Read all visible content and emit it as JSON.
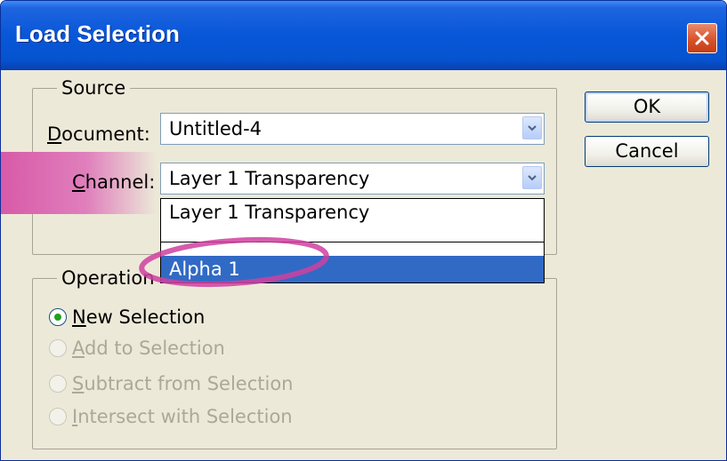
{
  "window": {
    "title": "Load Selection"
  },
  "source": {
    "legend": "Source",
    "document_label": "Document:",
    "document_value": "Untitled-4",
    "channel_label": "Channel:",
    "channel_value": "Layer 1 Transparency",
    "channel_options": [
      "Layer 1 Transparency",
      "Alpha 1"
    ],
    "channel_highlighted": "Alpha 1"
  },
  "operation": {
    "legend": "Operation",
    "options": [
      {
        "label": "New Selection",
        "selected": true,
        "enabled": true
      },
      {
        "label": "Add to Selection",
        "selected": false,
        "enabled": false
      },
      {
        "label": "Subtract from Selection",
        "selected": false,
        "enabled": false
      },
      {
        "label": "Intersect with Selection",
        "selected": false,
        "enabled": false
      }
    ]
  },
  "buttons": {
    "ok": "OK",
    "cancel": "Cancel"
  },
  "colors": {
    "titlebar": "#0757d8",
    "dialog_bg": "#ece9d8",
    "selection": "#316ac5",
    "annotation": "#d03fa0",
    "radio_dot": "#21a121"
  }
}
